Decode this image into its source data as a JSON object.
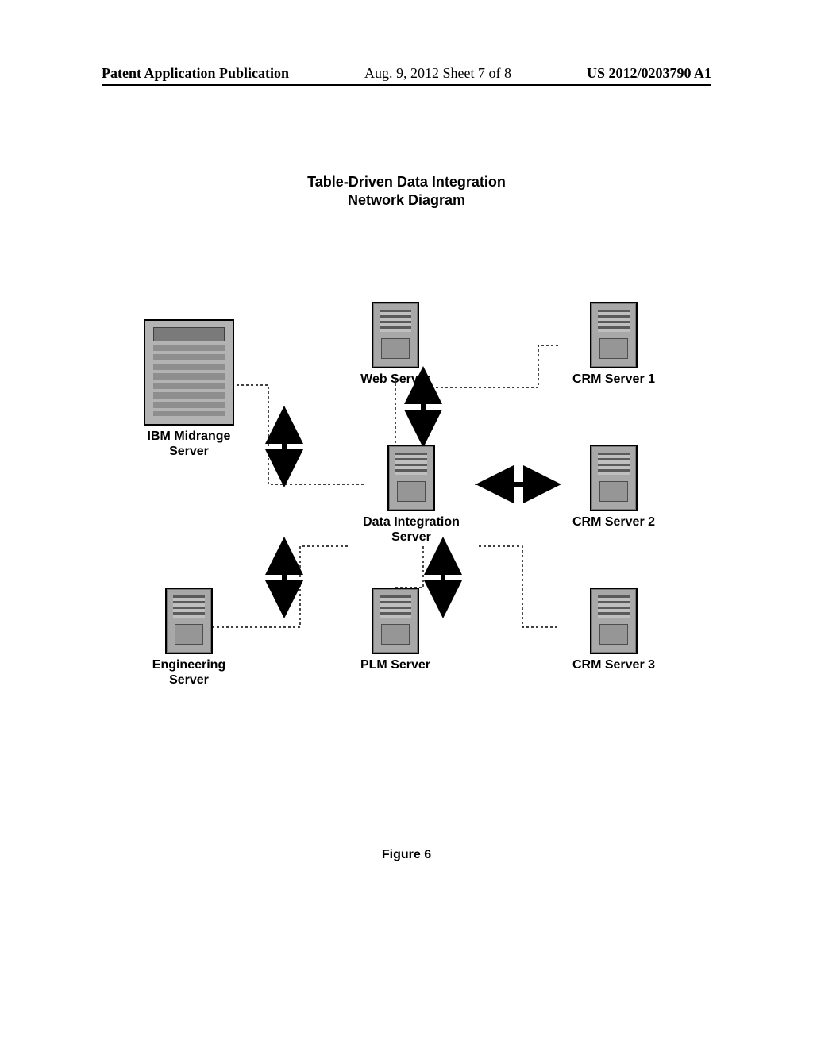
{
  "header": {
    "left": "Patent Application Publication",
    "center": "Aug. 9, 2012  Sheet 7 of 8",
    "right": "US 2012/0203790 A1"
  },
  "diagram": {
    "title_line1": "Table-Driven Data Integration",
    "title_line2": "Network Diagram",
    "nodes": {
      "midrange": "IBM Midrange\nServer",
      "web": "Web Server",
      "di": "Data Integration\nServer",
      "crm1": "CRM Server 1",
      "crm2": "CRM Server 2",
      "crm3": "CRM Server 3",
      "eng": "Engineering\nServer",
      "plm": "PLM Server"
    }
  },
  "figure_caption": "Figure 6"
}
